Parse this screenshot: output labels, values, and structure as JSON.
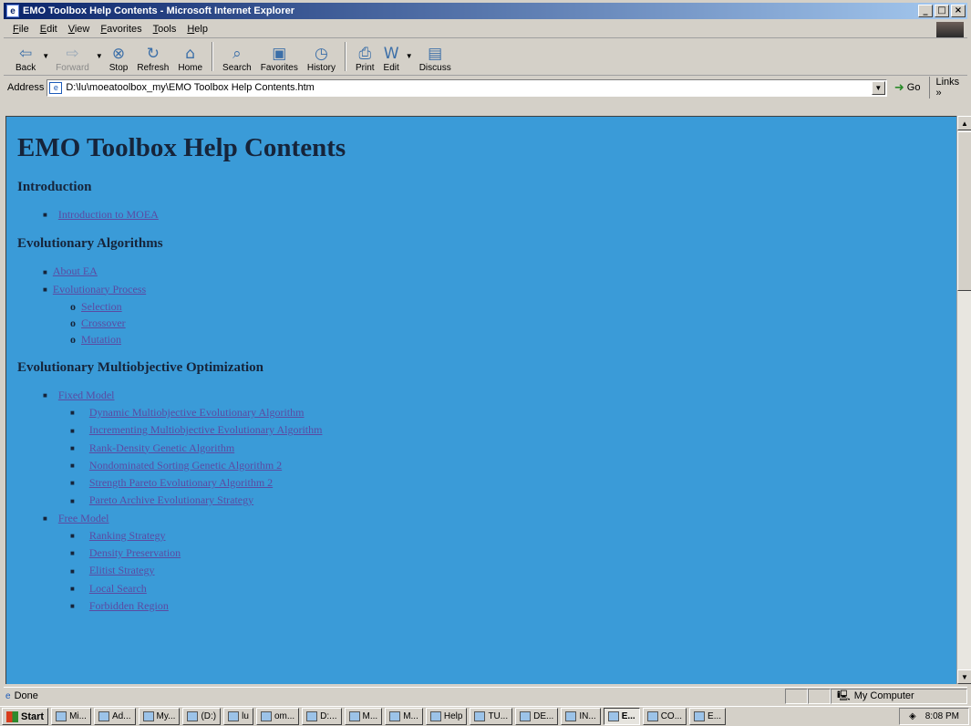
{
  "window": {
    "title": "EMO Toolbox Help Contents - Microsoft Internet Explorer"
  },
  "menu": [
    "File",
    "Edit",
    "View",
    "Favorites",
    "Tools",
    "Help"
  ],
  "toolbar": {
    "back": "Back",
    "forward": "Forward",
    "stop": "Stop",
    "refresh": "Refresh",
    "home": "Home",
    "search": "Search",
    "favorites": "Favorites",
    "history": "History",
    "print": "Print",
    "edit": "Edit",
    "discuss": "Discuss"
  },
  "address": {
    "label": "Address",
    "url": "D:\\lu\\moeatoolbox_my\\EMO Toolbox Help Contents.htm",
    "go": "Go",
    "links": "Links"
  },
  "page": {
    "title": "EMO Toolbox Help Contents",
    "sections": [
      {
        "heading": "Introduction",
        "items": [
          "Introduction to MOEA"
        ]
      },
      {
        "heading": "Evolutionary Algorithms",
        "items": [
          "About EA",
          "Evolutionary Process"
        ],
        "subitems": [
          "Selection",
          "Crossover",
          "Mutation"
        ]
      },
      {
        "heading": "Evolutionary Multiobjective Optimization",
        "fixed": "Fixed Model",
        "fixed_items": [
          "Dynamic Multiobjective Evolutionary Algorithm",
          "Incrementing Multiobjective Evolutionary Algorithm",
          "Rank-Density Genetic Algorithm",
          "Nondominated Sorting Genetic Algorithm 2",
          "Strength Pareto Evolutionary Algorithm 2",
          "Pareto Archive Evolutionary Strategy"
        ],
        "free": "Free Model",
        "free_items": [
          "Ranking Strategy",
          "Density Preservation",
          "Elitist Strategy",
          "Local Search",
          "Forbidden Region"
        ]
      }
    ]
  },
  "status": {
    "text": "Done",
    "zone": "My Computer"
  },
  "taskbar": {
    "start": "Start",
    "tasks": [
      "Mi...",
      "Ad...",
      "My...",
      "(D:)",
      "lu",
      "om...",
      "D:...",
      "M...",
      "M...",
      "Help",
      "TU...",
      "DE...",
      "IN...",
      "E...",
      "CO...",
      "E..."
    ],
    "clock": "8:08 PM"
  },
  "colors": {
    "page_background": "#3a9bd8",
    "link": "#5b4aa2",
    "titlebar": "#0a246a"
  }
}
